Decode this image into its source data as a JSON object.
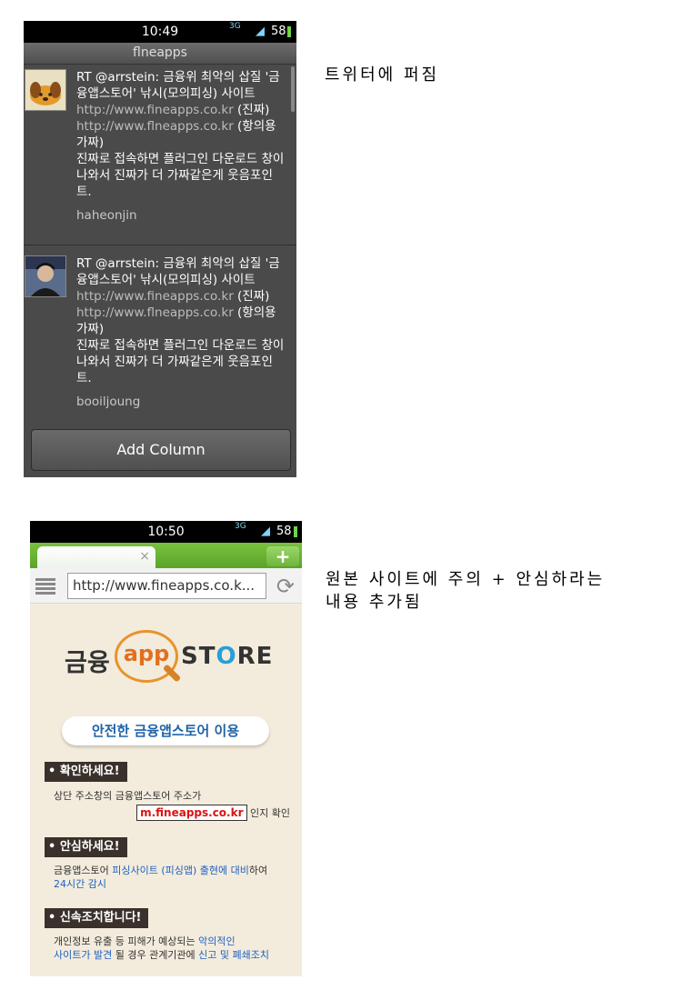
{
  "phone1": {
    "status": {
      "time": "10:49",
      "network": "3G",
      "signal_icon": "signal-icon",
      "battery": "58"
    },
    "title": "flneapps",
    "tweets": [
      {
        "text_line1": "RT @arrstein: 금융위 최악의 삽질 '금융앱스토어' 낚시(모의피싱) 사이트",
        "url1": "http://www.fineapps.co.kr",
        "url1_note": " (진짜)",
        "url2": "http://www.flneapps.co.kr",
        "url2_note": " (항의용 가짜)",
        "text_line2": "진짜로 접속하면 플러그인 다운로드 창이 나와서 진짜가 더 가짜같은게 웃음포인트.",
        "user": "haheonjin",
        "avatar": "dog-avatar"
      },
      {
        "text_line1": "RT @arrstein: 금융위 최악의 삽질 '금융앱스토어' 낚시(모의피싱) 사이트",
        "url1": "http://www.fineapps.co.kr",
        "url1_note": " (진짜)",
        "url2": "http://www.flneapps.co.kr",
        "url2_note": " (항의용 가짜)",
        "text_line2": "진짜로 접속하면 플러그인 다운로드 창이 나와서 진짜가 더 가짜같은게 웃음포인트.",
        "user": "booiljoung",
        "avatar": "person-avatar"
      }
    ],
    "add_column": "Add Column"
  },
  "caption1": "트위터에 퍼짐",
  "phone2": {
    "status": {
      "time": "10:50",
      "network": "3G",
      "battery": "58"
    },
    "tab_close": "×",
    "new_tab": "+",
    "url": "http://www.fineapps.co.k...",
    "reload_icon": "reload-icon",
    "logo": {
      "ko": "금융",
      "app": "app",
      "store_pre": "ST",
      "store_o": "O",
      "store_post": "RE"
    },
    "safe_button": "안전한 금융앱스토어 이용",
    "sections": {
      "check": {
        "title": "• 확인하세요!",
        "text": "상단 주소창의 금융앱스토어 주소가",
        "domain": "m.fineapps.co.kr",
        "suffix": " 인지 확인"
      },
      "relax": {
        "title": "• 안심하세요!",
        "text_pre": "금융앱스토어 ",
        "text_blue": "피싱사이트 (피싱앱) 출현에 대비",
        "text_post": "하여",
        "line2": "24시간 감시"
      },
      "action": {
        "title": "• 신속조치합니다!",
        "text_pre": "개인정보 유출 등 피해가 예상되는 ",
        "text_blue1": "악의적인",
        "line2_blue": "사이트가 발견",
        "line2_mid": " 될 경우 관계기관에 ",
        "line2_blue2": "신고 및 폐쇄조치"
      }
    }
  },
  "caption2_line1": "원본 사이트에 주의 + 안심하라는",
  "caption2_line2": "내용 추가됨",
  "colors": {
    "browser_green": "#6cb535",
    "accent_orange": "#e36f1e",
    "link_blue": "#1e5fc0",
    "domain_red": "#dd1111"
  }
}
